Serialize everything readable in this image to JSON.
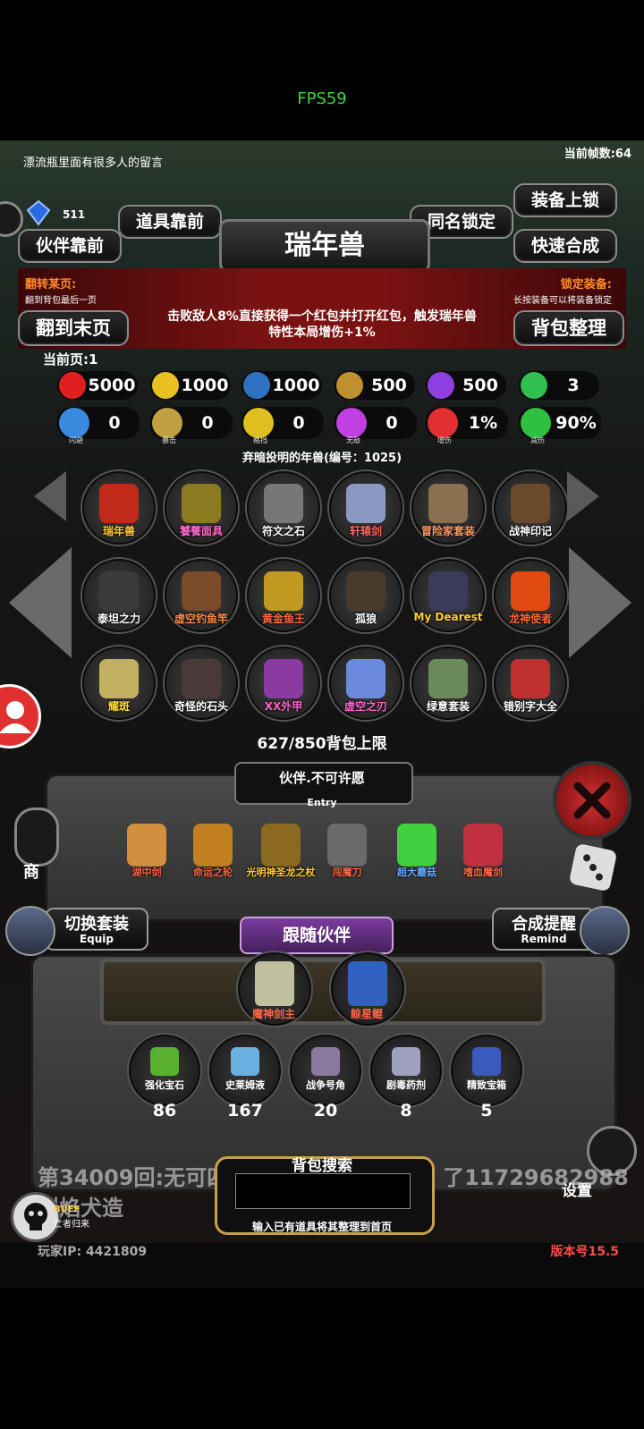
{
  "status": {
    "fps": "FPS59"
  },
  "top": {
    "message": "漂流瓶里面有很多人的留言",
    "framerate": "当前帧数:64",
    "gem_count": "511"
  },
  "buttons": {
    "item_front": "道具靠前",
    "partner_front": "伙伴靠前",
    "same_name_lock": "同名锁定",
    "equip_lock": "装备上锁",
    "quick_merge": "快速合成",
    "to_last_page": "翻到末页",
    "bag_sort": "背包整理"
  },
  "title": "瑞年兽",
  "flip": {
    "label": "翻转某页:",
    "sub": "翻到背包最后一页"
  },
  "lock_equip": {
    "label": "锁定装备:",
    "sub": "长按装备可以将装备锁定"
  },
  "description": [
    "击败敌人8%直接获得一个红包并打开红包，触发瑞年兽",
    "特性本局增伤+1%"
  ],
  "current_page": "当前页:1",
  "stats_row1": [
    {
      "icon": "heart-icon",
      "color": "#e02020",
      "value": "5000"
    },
    {
      "icon": "strength-icon",
      "color": "#e8c020",
      "value": "1000"
    },
    {
      "icon": "helmet-icon",
      "color": "#3070c0",
      "value": "1000"
    },
    {
      "icon": "sword-icon",
      "color": "#c09030",
      "value": "500"
    },
    {
      "icon": "lightning-icon",
      "color": "#9040e0",
      "value": "500"
    },
    {
      "icon": "clover-icon",
      "color": "#30c050",
      "value": "3"
    }
  ],
  "stats_row2": [
    {
      "icon": "dodge-icon",
      "color": "#3a8ae0",
      "label": "闪避",
      "value": "0"
    },
    {
      "icon": "crit-icon",
      "color": "#c0a040",
      "label": "暴击",
      "value": "0"
    },
    {
      "icon": "block-icon",
      "color": "#e0c020",
      "label": "格挡",
      "value": "0"
    },
    {
      "icon": "invincible-icon",
      "color": "#c040e0",
      "label": "无敌",
      "value": "0"
    },
    {
      "icon": "damage-up-icon",
      "color": "#e03030",
      "label": "增伤",
      "value": "1%"
    },
    {
      "icon": "damage-reduce-icon",
      "color": "#30c040",
      "label": "减伤",
      "value": "90%"
    }
  ],
  "set_name": "弃暗投明的年兽(编号：1025)",
  "items": [
    {
      "name": "瑞年兽",
      "color": "#ffcc33",
      "art": "#c02a1a"
    },
    {
      "name": "饕餮面具",
      "color": "#ff66cc",
      "art": "#8a7a20"
    },
    {
      "name": "符文之石",
      "color": "#ffffff",
      "art": "#777777"
    },
    {
      "name": "轩辕剑",
      "color": "#ff6666",
      "art": "#8a9ac0"
    },
    {
      "name": "冒险家套装",
      "color": "#ff9966",
      "art": "#8a7050"
    },
    {
      "name": "战神印记",
      "color": "#ffffff",
      "art": "#6a4a2a"
    },
    {
      "name": "泰坦之力",
      "color": "#ffffff",
      "art": "#3a3a3a"
    },
    {
      "name": "虚空钓鱼竿",
      "color": "#ff8844",
      "art": "#7a4a2a"
    },
    {
      "name": "黄金鱼王",
      "color": "#ff6644",
      "art": "#c09a20"
    },
    {
      "name": "孤狼",
      "color": "#ffffff",
      "art": "#4a3a2a"
    },
    {
      "name": "My Dearest",
      "color": "#ffcc33",
      "art": "#3a3a5a"
    },
    {
      "name": "龙神使者",
      "color": "#ff6633",
      "art": "#e04a10"
    },
    {
      "name": "耀斑",
      "color": "#ffdd33",
      "art": "#c0b060"
    },
    {
      "name": "奇怪的石头",
      "color": "#ffffff",
      "art": "#4a3a3a"
    },
    {
      "name": "XX外甲",
      "color": "#ff66cc",
      "art": "#8a3aa0"
    },
    {
      "name": "虚空之刃",
      "color": "#ff66cc",
      "art": "#6a8ae0"
    },
    {
      "name": "绿意套装",
      "color": "#ffffff",
      "art": "#6a8a5a"
    },
    {
      "name": "错别字大全",
      "color": "#ffffff",
      "art": "#c03030"
    }
  ],
  "capacity": "627/850背包上限",
  "partner": {
    "name": "伙伴.不可许愿",
    "entry": "Entry"
  },
  "equipment": [
    {
      "name": "湖中剑",
      "color": "#ff6644",
      "art": "#d09040"
    },
    {
      "name": "命运之轮",
      "color": "#ff6644",
      "art": "#c08020"
    },
    {
      "name": "光明神圣龙之杖",
      "color": "#ffcc33",
      "art": "#8a6a20"
    },
    {
      "name": "闯魔刀",
      "color": "#ff6644",
      "art": "#6a6a6a"
    },
    {
      "name": "超大蘑菇",
      "color": "#66aaff",
      "art": "#40d040"
    },
    {
      "name": "嗜血魔剑",
      "color": "#ff6644",
      "art": "#c03040"
    }
  ],
  "switch_set": {
    "label": "切换套装",
    "sub": "Equip"
  },
  "merge_remind": {
    "label": "合成提醒",
    "sub": "Remind"
  },
  "follow": {
    "title": "跟随伙伴",
    "partners": [
      {
        "name": "魔神剑主",
        "color": "#ff6644",
        "art": "#c0c0a0"
      },
      {
        "name": "鲸星鲲",
        "color": "#ff6644",
        "art": "#3060c0"
      }
    ]
  },
  "materials": [
    {
      "name": "强化宝石",
      "count": "86",
      "art": "#5ab030"
    },
    {
      "name": "史莱姆液",
      "count": "167",
      "art": "#6ab0e0"
    },
    {
      "name": "战争号角",
      "count": "20",
      "art": "#8a7aa0"
    },
    {
      "name": "剧毒药剂",
      "count": "8",
      "art": "#a0a0c0"
    },
    {
      "name": "精致宝箱",
      "count": "5",
      "art": "#3a5ac0"
    }
  ],
  "search": {
    "title": "背包搜索",
    "value": "",
    "hint": "输入已有道具将其整理到首页"
  },
  "ticker": [
    "第34009回:无可四",
    "烈焰犬造",
    "了11729682988"
  ],
  "buff": {
    "label": "BUFF",
    "sub": "亡者归来"
  },
  "side": {
    "shop": "商",
    "settings": "设置"
  },
  "footer": {
    "player_ip": "玩家IP:  4421809",
    "version": "版本号15.5"
  }
}
